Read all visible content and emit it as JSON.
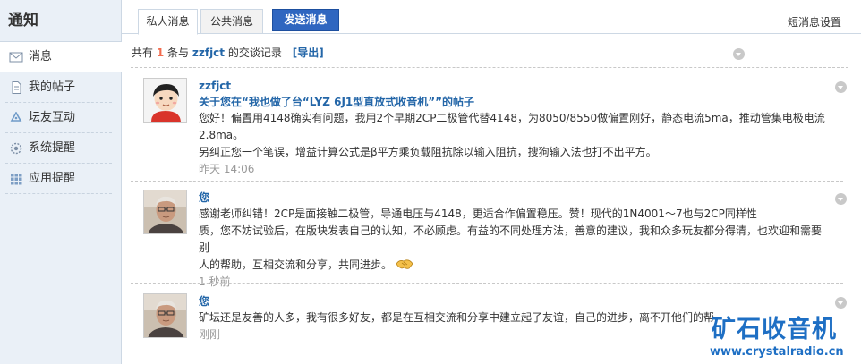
{
  "sidebar": {
    "title": "通知",
    "items": [
      {
        "label": "消息",
        "icon": "envelope-icon"
      },
      {
        "label": "我的帖子",
        "icon": "document-icon"
      },
      {
        "label": "坛友互动",
        "icon": "recycle-icon"
      },
      {
        "label": "系统提醒",
        "icon": "gear-icon"
      },
      {
        "label": "应用提醒",
        "icon": "grid-icon"
      }
    ]
  },
  "tabs": {
    "private": "私人消息",
    "public": "公共消息",
    "send": "发送消息",
    "settings": "短消息设置"
  },
  "summary": {
    "prefix": "共有",
    "count": "1",
    "middle": "条与",
    "username": "zzfjct",
    "suffix": "的交谈记录",
    "export": "[导出]"
  },
  "messages": [
    {
      "sender": "zzfjct",
      "subject": "关于您在“我也做了台“LYZ 6J1型直放式收音机””的帖子",
      "lines": [
        "您好！偏置用4148确实有问题，我用2个早期2CP二极管代替4148，为8050/8550做偏置刚好，静态电流5ma，推动管集电极电流",
        "2.8ma。",
        "另纠正您一个笔误，增益计算公式是β平方乘负载阻抗除以输入阻抗，搜狗输入法也打不出平方。"
      ],
      "time": "昨天 14:06"
    },
    {
      "sender": "您",
      "lines": [
        "感谢老师纠错！2CP是面接触二极管，导通电压与4148，更适合作偏置稳压。赞！现代的1N4001～7也与2CP同样性",
        "质，您不妨试验后，在版块发表自己的认知，不必顾虑。有益的不同处理方法，善意的建议，我和众多玩友都分得清，也欢迎和需要别",
        "人的帮助，互相交流和分享，共同进步。"
      ],
      "time": "1 秒前"
    },
    {
      "sender": "您",
      "lines": [
        "矿坛还是友善的人多，我有很多好友，都是在互相交流和分享中建立起了友谊，自己的进步，离不开他们的帮"
      ],
      "time": "刚刚"
    }
  ],
  "watermark": {
    "title": "矿石收音机",
    "url": "www.crystalradio.cn"
  },
  "colors": {
    "link": "#2366a8",
    "accent_count": "#f26c4f",
    "send_button": "#2f66c0",
    "sidebar_bg": "#eaf0f7"
  }
}
